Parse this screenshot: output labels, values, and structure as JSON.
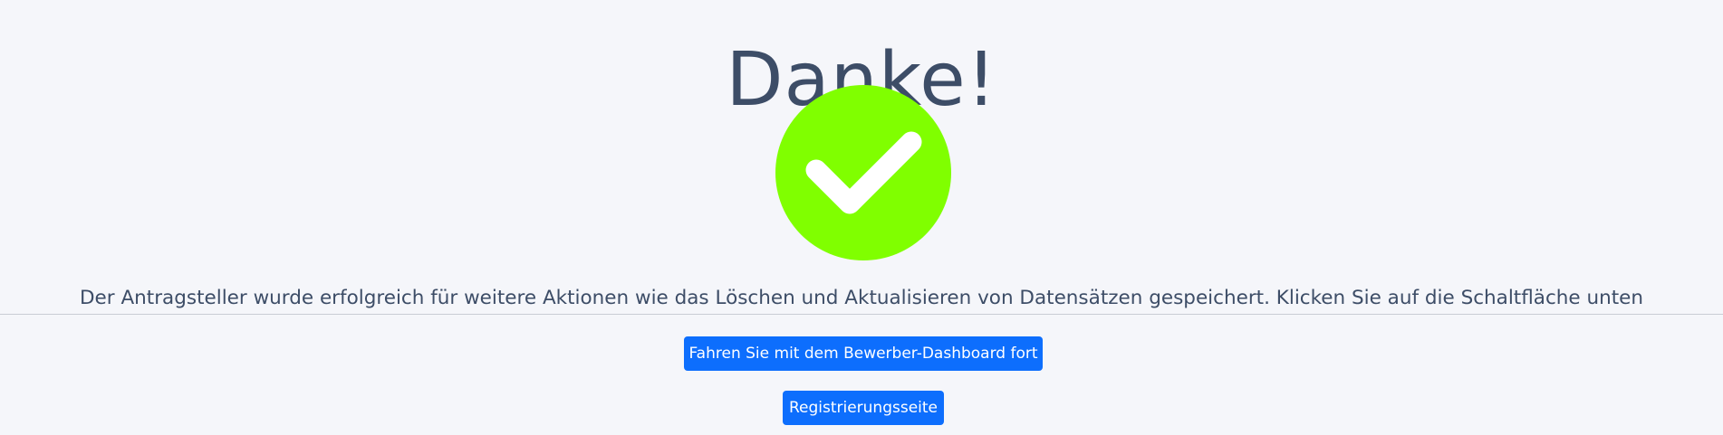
{
  "page": {
    "title": "Danke!",
    "success_icon": "checkmark-circle-icon",
    "message": "Der Antragsteller wurde erfolgreich für weitere Aktionen wie das Löschen und Aktualisieren von Datensätzen gespeichert. Klicken Sie auf die Schaltfläche unten"
  },
  "buttons": {
    "dashboard_label": "Fahren Sie mit dem Bewerber-Dashboard fort",
    "register_label": "Registrierungsseite"
  },
  "colors": {
    "background": "#f5f6fa",
    "text": "#3d4d67",
    "success_green": "#80ff00",
    "button_blue": "#0d6efd",
    "divider": "#c9cdd4"
  }
}
